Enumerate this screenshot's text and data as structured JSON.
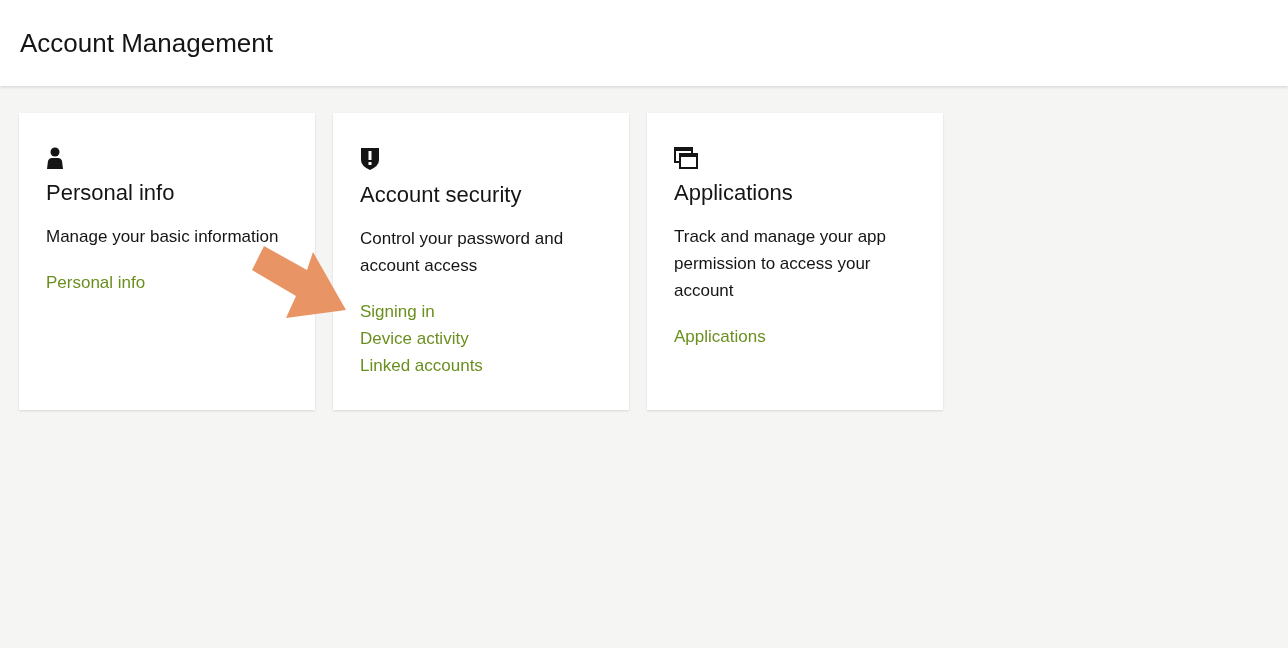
{
  "header": {
    "title": "Account Management"
  },
  "cards": [
    {
      "title": "Personal info",
      "description": "Manage your basic information",
      "links": [
        "Personal info"
      ]
    },
    {
      "title": "Account security",
      "description": "Control your password and account access",
      "links": [
        "Signing in",
        "Device activity",
        "Linked accounts"
      ]
    },
    {
      "title": "Applications",
      "description": "Track and manage your app permission to access your account",
      "links": [
        "Applications"
      ]
    }
  ]
}
